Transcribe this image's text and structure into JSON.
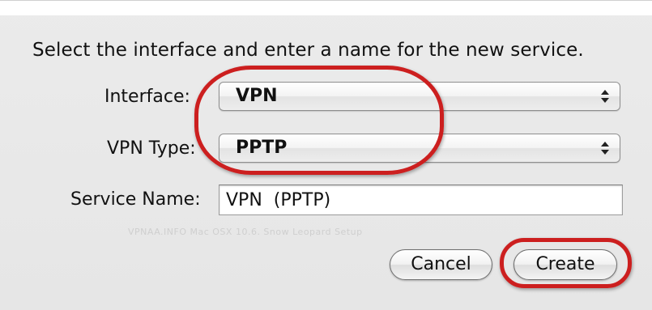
{
  "dialog": {
    "instruction": "Select the interface and enter a name for the new service."
  },
  "fields": {
    "interface": {
      "label": "Interface:",
      "value": "VPN"
    },
    "vpn_type": {
      "label": "VPN Type:",
      "value": "PPTP"
    },
    "service_name": {
      "label": "Service Name:",
      "value": "VPN  (PPTP)"
    }
  },
  "buttons": {
    "cancel": "Cancel",
    "create": "Create"
  },
  "watermark": "VPNAA.INFO Mac OSX 10.6. Snow Leopard Setup",
  "colors": {
    "annotation": "#cc1f1f",
    "dialog_bg": "#e9e9e9"
  }
}
